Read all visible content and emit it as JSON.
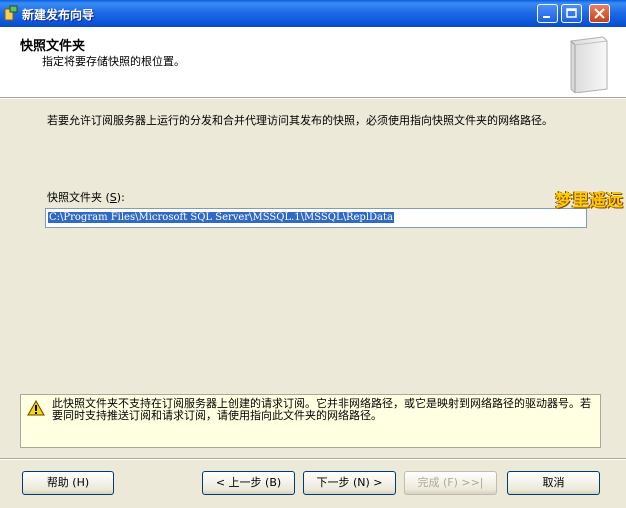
{
  "window": {
    "title": "新建发布向导"
  },
  "header": {
    "title": "快照文件夹",
    "subtitle": "指定将要存储快照的根位置。"
  },
  "body": {
    "description": "若要允许订阅服务器上运行的分发和合并代理访问其发布的快照，必须使用指向快照文件夹的网络路径。",
    "folder_label_prefix": "快照文件夹 (",
    "folder_label_key": "S",
    "folder_label_suffix": "):",
    "folder_value": "C:\\Program Files\\Microsoft SQL Server\\MSSQL.1\\MSSQL\\ReplData"
  },
  "watermark": "梦里遥远",
  "warning": {
    "icon": "warning-icon",
    "text": "此快照文件夹不支持在订阅服务器上创建的请求订阅。它并非网络路径，或它是映射到网络路径的驱动器号。若要同时支持推送订阅和请求订阅，请使用指向此文件夹的网络路径。"
  },
  "buttons": {
    "help": "帮助 (H)",
    "back": "< 上一步 (B)",
    "next": "下一步 (N) >",
    "finish": "完成 (F) >>|",
    "cancel": "取消"
  }
}
